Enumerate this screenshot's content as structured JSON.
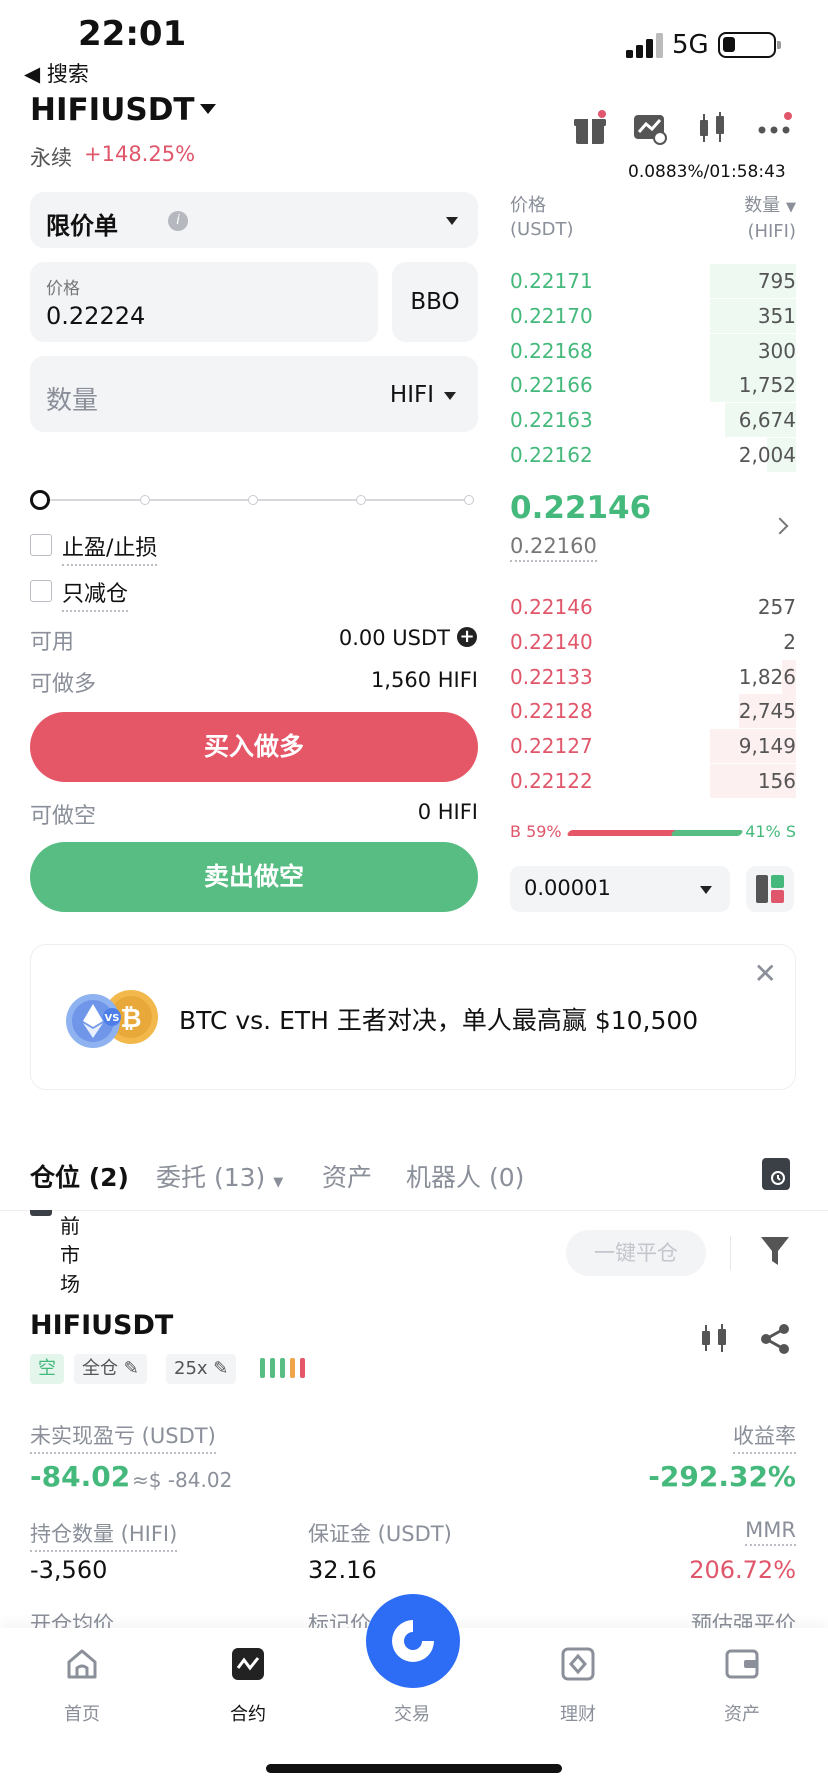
{
  "status_bar": {
    "time": "22:01",
    "back_label": "◀ 搜索",
    "network": "5G"
  },
  "header": {
    "pair": "HIFIUSDT",
    "perpetual": "永续",
    "change_pct": "+148.25%",
    "funding": "0.0883%/01:58:43"
  },
  "order_form": {
    "order_type": "限价单",
    "price_label": "价格",
    "price_value": "0.22224",
    "bbo_label": "BBO",
    "qty_label": "数量",
    "qty_unit": "HIFI",
    "tpsl_label": "止盈/止损",
    "reduce_only_label": "只减仓",
    "available_label": "可用",
    "available_value": "0.00 USDT",
    "long_max_label": "可做多",
    "long_max_value": "1,560 HIFI",
    "buy_label": "买入做多",
    "short_max_label": "可做空",
    "short_max_value": "0 HIFI",
    "sell_label": "卖出做空"
  },
  "order_book": {
    "price_header": "价格",
    "price_unit": "(USDT)",
    "qty_header": "数量",
    "qty_unit": "(HIFI)",
    "asks": [
      {
        "price": "0.22171",
        "qty": "795",
        "depth": 0.3
      },
      {
        "price": "0.22170",
        "qty": "351",
        "depth": 0.3
      },
      {
        "price": "0.22168",
        "qty": "300",
        "depth": 0.3
      },
      {
        "price": "0.22166",
        "qty": "1,752",
        "depth": 0.3
      },
      {
        "price": "0.22163",
        "qty": "6,674",
        "depth": 0.25
      },
      {
        "price": "0.22162",
        "qty": "2,004",
        "depth": 0.1
      }
    ],
    "last_price": "0.22146",
    "mark_price": "0.22160",
    "bids": [
      {
        "price": "0.22146",
        "qty": "257",
        "depth": 0.0
      },
      {
        "price": "0.22140",
        "qty": "2",
        "depth": 0.0
      },
      {
        "price": "0.22133",
        "qty": "1,826",
        "depth": 0.05
      },
      {
        "price": "0.22128",
        "qty": "2,745",
        "depth": 0.2
      },
      {
        "price": "0.22127",
        "qty": "9,149",
        "depth": 0.3
      },
      {
        "price": "0.22122",
        "qty": "156",
        "depth": 0.3
      }
    ],
    "buy_ratio": "B 59%",
    "sell_ratio": "41% S",
    "precision": "0.00001"
  },
  "banner": {
    "text": "BTC vs. ETH 王者对决，单人最高赢 $10,500",
    "coin_badge": "VS"
  },
  "tabs": {
    "positions": "仓位 (2)",
    "orders": "委托 (13)",
    "assets": "资产",
    "bots": "机器人 (0)"
  },
  "positions": {
    "filter_text": "前\n市\n场",
    "close_all": "一键平仓",
    "symbol": "HIFIUSDT",
    "side": "空",
    "margin_mode": "全仓",
    "leverage": "25x",
    "upnl_label": "未实现盈亏 (USDT)",
    "upnl_value": "-84.02",
    "upnl_usd": "≈$ -84.02",
    "roe_label": "收益率",
    "roe_value": "-292.32%",
    "size_label": "持仓数量 (HIFI)",
    "size_value": "-3,560",
    "margin_label": "保证金 (USDT)",
    "margin_value": "32.16",
    "mmr_label": "MMR",
    "mmr_value": "206.72%",
    "entry_label": "开仓均价",
    "mark_label": "标记价",
    "liq_label": "预估强平价"
  },
  "nav": {
    "home": "首页",
    "futures": "合约",
    "trade": "交易",
    "earn": "理财",
    "assets": "资产"
  },
  "colors": {
    "green": "#45b97c",
    "red": "#e0566a",
    "brand_blue": "#2d6df6"
  }
}
